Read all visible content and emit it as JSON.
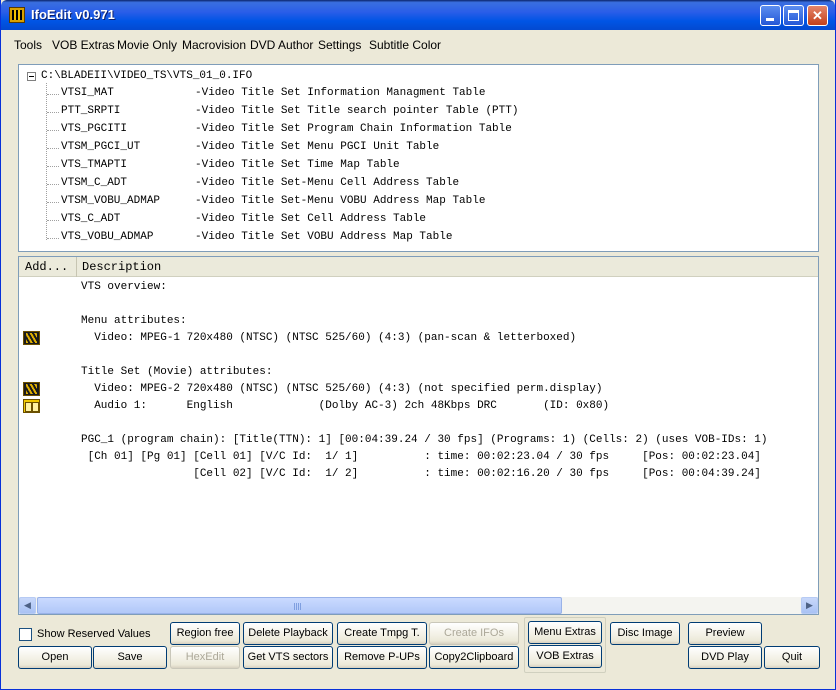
{
  "window": {
    "title": "IfoEdit v0.971"
  },
  "menu": [
    "Tools",
    "VOB Extras",
    "Movie Only",
    "Macrovision",
    "DVD Author",
    "Settings",
    "Subtitle Color"
  ],
  "tree": {
    "root": "C:\\BLADEII\\VIDEO_TS\\VTS_01_0.IFO",
    "items": [
      {
        "name": "VTSI_MAT",
        "desc": "-Video Title Set Information Managment Table"
      },
      {
        "name": "PTT_SRPTI",
        "desc": "-Video Title Set Title search pointer Table (PTT)"
      },
      {
        "name": "VTS_PGCITI",
        "desc": "-Video Title Set Program Chain Information Table"
      },
      {
        "name": "VTSM_PGCI_UT",
        "desc": "-Video Title Set Menu PGCI Unit Table"
      },
      {
        "name": "VTS_TMAPTI",
        "desc": "-Video Title Set Time Map Table"
      },
      {
        "name": "VTSM_C_ADT",
        "desc": "-Video Title Set-Menu Cell Address Table"
      },
      {
        "name": "VTSM_VOBU_ADMAP",
        "desc": "-Video Title Set-Menu VOBU Address Map Table"
      },
      {
        "name": "VTS_C_ADT",
        "desc": "-Video Title Set Cell Address Table"
      },
      {
        "name": "VTS_VOBU_ADMAP",
        "desc": "-Video Title Set VOBU Address Map Table"
      }
    ]
  },
  "list": {
    "columns": [
      "Add...",
      "Description"
    ],
    "lines": [
      "VTS overview:",
      "",
      "Menu attributes:",
      "  Video: MPEG-1 720x480 (NTSC) (NTSC 525/60) (4:3) (pan-scan & letterboxed)",
      "",
      "Title Set (Movie) attributes:",
      "  Video: MPEG-2 720x480 (NTSC) (NTSC 525/60) (4:3) (not specified perm.display)",
      "  Audio 1:      English             (Dolby AC-3) 2ch 48Kbps DRC       (ID: 0x80)",
      "",
      "PGC_1 (program chain): [Title(TTN): 1] [00:04:39.24 / 30 fps] (Programs: 1) (Cells: 2) (uses VOB-IDs: 1)",
      " [Ch 01] [Pg 01] [Cell 01] [V/C Id:  1/ 1]          : time: 00:02:23.04 / 30 fps     [Pos: 00:02:23.04]",
      "                 [Cell 02] [V/C Id:  1/ 2]          : time: 00:02:16.20 / 30 fps     [Pos: 00:04:39.24]"
    ],
    "icons": [
      "film-icon",
      "film-icon",
      "audio-icon"
    ]
  },
  "controls": {
    "show_reserved": "Show Reserved Values",
    "open": "Open",
    "save": "Save",
    "region_free": "Region free",
    "hexedit": "HexEdit",
    "delete_playback": "Delete Playback",
    "get_vts_sectors": "Get VTS sectors",
    "create_tmpg": "Create Tmpg T.",
    "remove_pups": "Remove P-UPs",
    "create_ifos": "Create IFOs",
    "copy2clipboard": "Copy2Clipboard",
    "menu_extras": "Menu Extras",
    "vob_extras": "VOB Extras",
    "disc_image": "Disc Image",
    "preview": "Preview",
    "dvd_play": "DVD Play",
    "quit": "Quit"
  }
}
